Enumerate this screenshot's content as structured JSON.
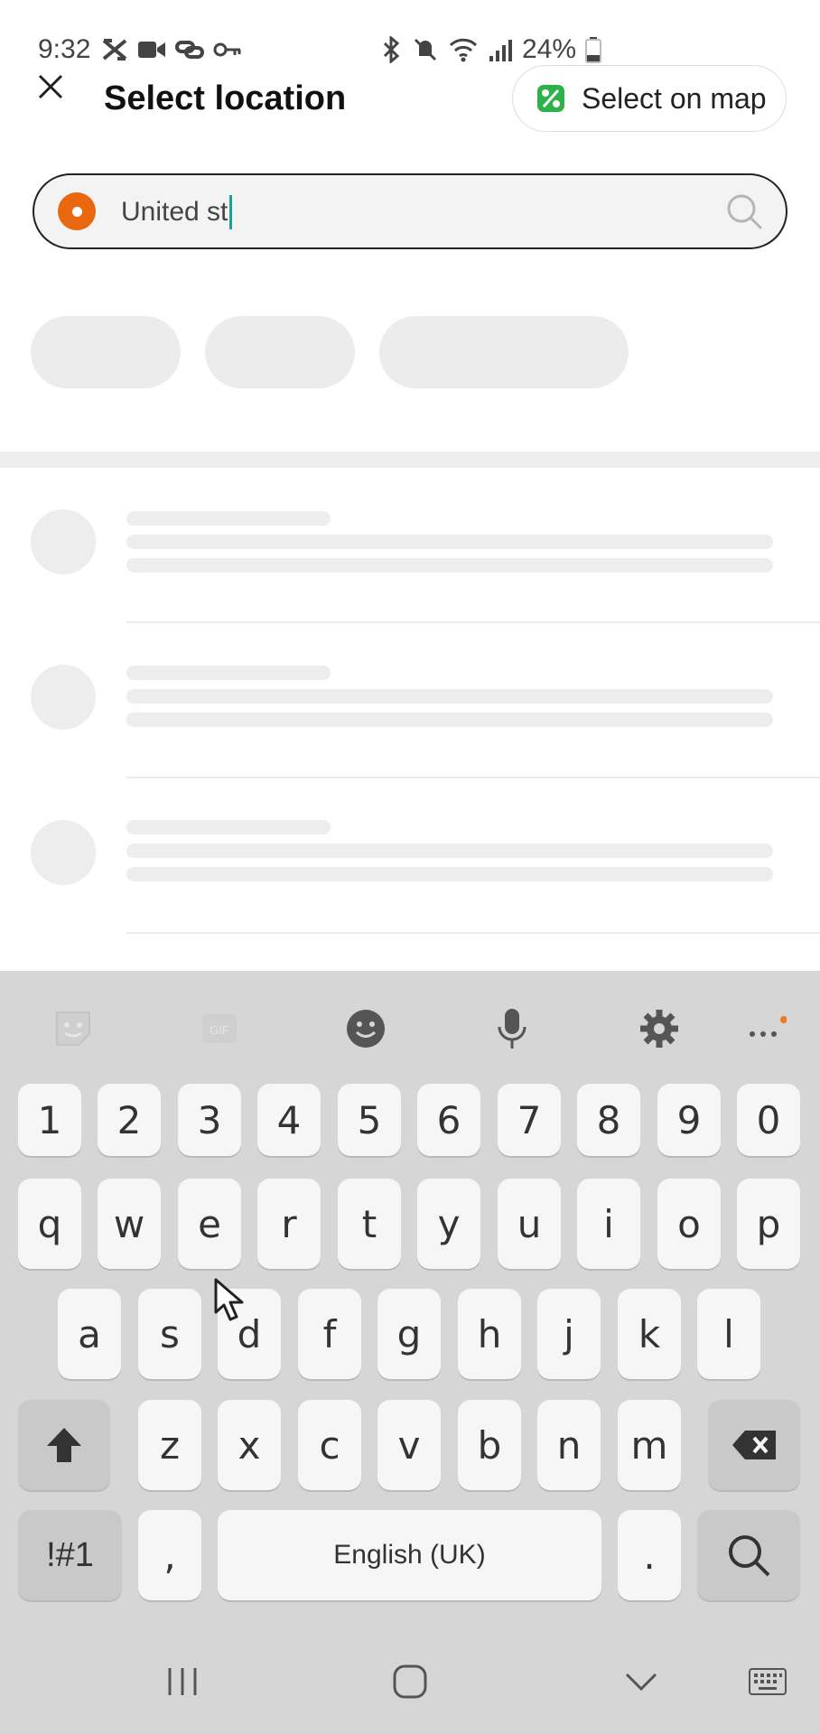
{
  "status_bar": {
    "time": "9:32",
    "battery": "24%"
  },
  "header": {
    "title": "Select location",
    "map_button_label": "Select on map"
  },
  "search": {
    "value": "United st"
  },
  "keyboard": {
    "number_row": [
      "1",
      "2",
      "3",
      "4",
      "5",
      "6",
      "7",
      "8",
      "9",
      "0"
    ],
    "row1": [
      "q",
      "w",
      "e",
      "r",
      "t",
      "y",
      "u",
      "i",
      "o",
      "p"
    ],
    "row2": [
      "a",
      "s",
      "d",
      "f",
      "g",
      "h",
      "j",
      "k",
      "l"
    ],
    "row3": [
      "z",
      "x",
      "c",
      "v",
      "b",
      "n",
      "m"
    ],
    "symbols_key": "!#1",
    "comma_key": ",",
    "space_label": "English (UK)",
    "period_key": "."
  }
}
